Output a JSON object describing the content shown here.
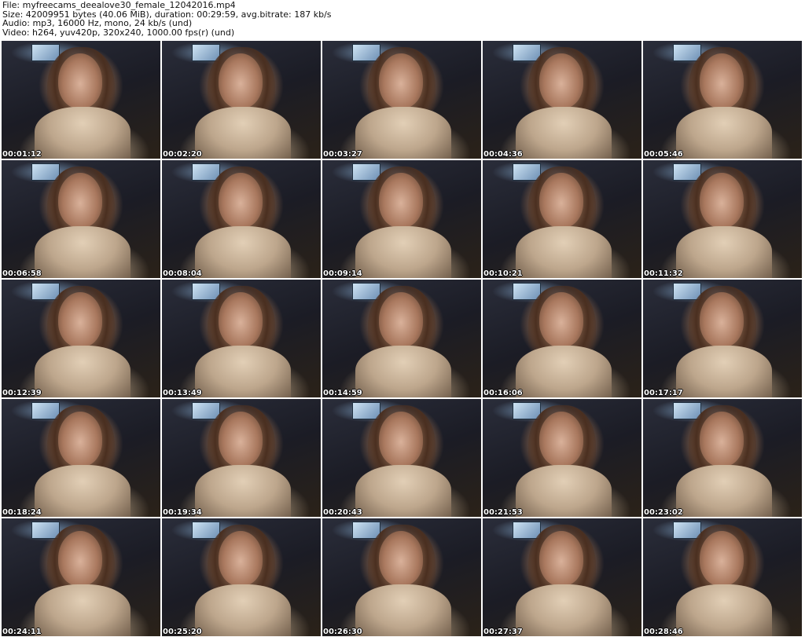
{
  "header": {
    "file_line": "File: myfreecams_deealove30_female_12042016.mp4",
    "size_line": "Size: 42009951 bytes (40.06 MiB), duration: 00:29:59, avg.bitrate: 187 kb/s",
    "audio_line": "Audio: mp3, 16000 Hz, mono, 24 kb/s (und)",
    "video_line": "Video: h264, yuv420p, 320x240, 1000.00 fps(r) (und)"
  },
  "thumbnails": [
    "00:01:12",
    "00:02:20",
    "00:03:27",
    "00:04:36",
    "00:05:46",
    "00:06:58",
    "00:08:04",
    "00:09:14",
    "00:10:21",
    "00:11:32",
    "00:12:39",
    "00:13:49",
    "00:14:59",
    "00:16:06",
    "00:17:17",
    "00:18:24",
    "00:19:34",
    "00:20:43",
    "00:21:53",
    "00:23:02",
    "00:24:11",
    "00:25:20",
    "00:26:30",
    "00:27:37",
    "00:28:46"
  ]
}
